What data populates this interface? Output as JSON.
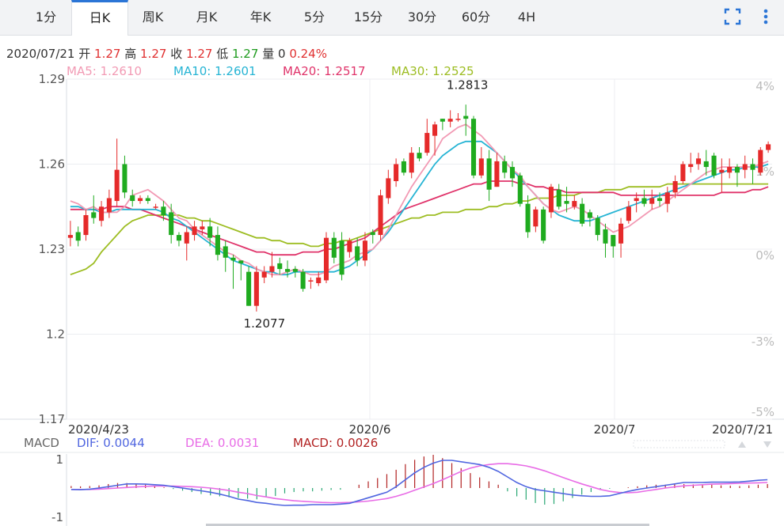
{
  "tabs": [
    {
      "label": "1分",
      "active": false
    },
    {
      "label": "日K",
      "active": true
    },
    {
      "label": "周K",
      "active": false
    },
    {
      "label": "月K",
      "active": false
    },
    {
      "label": "年K",
      "active": false
    },
    {
      "label": "5分",
      "active": false
    },
    {
      "label": "15分",
      "active": false
    },
    {
      "label": "30分",
      "active": false
    },
    {
      "label": "60分",
      "active": false
    },
    {
      "label": "4H",
      "active": false
    }
  ],
  "tools": {
    "fullscreen_icon": "fullscreen-icon",
    "more_icon": "more-vertical-icon"
  },
  "info": {
    "date": "2020/07/21",
    "open_label": "开",
    "open": "1.27",
    "high_label": "高",
    "high": "1.27",
    "close_label": "收",
    "close": "1.27",
    "low_label": "低",
    "low": "1.27",
    "vol_label": "量",
    "vol": "0",
    "change": "0.24%"
  },
  "ma": {
    "ma5": "MA5: 1.2610",
    "ma10": "MA10: 1.2601",
    "ma20": "MA20: 1.2517",
    "ma30": "MA30: 1.2525"
  },
  "macd_labels": {
    "title": "MACD",
    "dif": "DIF: 0.0044",
    "dea": "DEA: 0.0031",
    "macd": "MACD: 0.0026"
  },
  "colors": {
    "up": "#e52a2a",
    "down": "#1fab1f",
    "ma5": "#f29ab4",
    "ma10": "#26b4d4",
    "ma20": "#e0336a",
    "ma30": "#9dbd22",
    "dif": "#5066e0",
    "dea": "#e86ce6",
    "hist_pos": "#b22222",
    "hist_neg": "#2aa874"
  },
  "chart_data": {
    "type": "candlestick",
    "price_axis": {
      "ylim": [
        1.17,
        1.29
      ],
      "ticks": [
        "1.29",
        "1.26",
        "1.23",
        "1.2",
        "1.17"
      ]
    },
    "pct_axis": {
      "ticks": [
        "4%",
        "1%",
        "0%",
        "-3%",
        "-5%"
      ]
    },
    "x_labels": [
      "2020/4/23",
      "2020/6",
      "2020/7",
      "2020/7/21"
    ],
    "annotations": {
      "max": "1.2813",
      "min": "1.2077"
    },
    "candles": [
      [
        1.234,
        1.235,
        1.24,
        1.231
      ],
      [
        1.236,
        1.233,
        1.238,
        1.231
      ],
      [
        1.235,
        1.242,
        1.244,
        1.233
      ],
      [
        1.243,
        1.241,
        1.249,
        1.239
      ],
      [
        1.24,
        1.245,
        1.247,
        1.238
      ],
      [
        1.243,
        1.248,
        1.251,
        1.241
      ],
      [
        1.247,
        1.258,
        1.269,
        1.245
      ],
      [
        1.26,
        1.25,
        1.263,
        1.248
      ],
      [
        1.249,
        1.247,
        1.251,
        1.245
      ],
      [
        1.247,
        1.248,
        1.249,
        1.246
      ],
      [
        1.248,
        1.247,
        1.249,
        1.246
      ],
      [
        1.245,
        1.245,
        1.246,
        1.244
      ],
      [
        1.245,
        1.242,
        1.247,
        1.24
      ],
      [
        1.243,
        1.235,
        1.246,
        1.232
      ],
      [
        1.235,
        1.233,
        1.236,
        1.231
      ],
      [
        1.232,
        1.236,
        1.238,
        1.226
      ],
      [
        1.235,
        1.238,
        1.24,
        1.233
      ],
      [
        1.237,
        1.238,
        1.24,
        1.235
      ],
      [
        1.238,
        1.234,
        1.241,
        1.231
      ],
      [
        1.235,
        1.228,
        1.238,
        1.226
      ],
      [
        1.231,
        1.227,
        1.233,
        1.222
      ],
      [
        1.227,
        1.226,
        1.228,
        1.216
      ],
      [
        1.226,
        1.225,
        1.226,
        1.219
      ],
      [
        1.222,
        1.21,
        1.224,
        1.21
      ],
      [
        1.21,
        1.222,
        1.224,
        1.208
      ],
      [
        1.22,
        1.222,
        1.224,
        1.218
      ],
      [
        1.222,
        1.224,
        1.229,
        1.22
      ],
      [
        1.225,
        1.223,
        1.227,
        1.221
      ],
      [
        1.223,
        1.222,
        1.226,
        1.22
      ],
      [
        1.223,
        1.222,
        1.224,
        1.22
      ],
      [
        1.222,
        1.216,
        1.223,
        1.215
      ],
      [
        1.219,
        1.219,
        1.22,
        1.216
      ],
      [
        1.218,
        1.22,
        1.222,
        1.217
      ],
      [
        1.219,
        1.234,
        1.236,
        1.218
      ],
      [
        1.234,
        1.227,
        1.236,
        1.225
      ],
      [
        1.233,
        1.221,
        1.236,
        1.219
      ],
      [
        1.229,
        1.233,
        1.234,
        1.227
      ],
      [
        1.231,
        1.226,
        1.234,
        1.224
      ],
      [
        1.226,
        1.233,
        1.236,
        1.224
      ],
      [
        1.236,
        1.235,
        1.237,
        1.232
      ],
      [
        1.235,
        1.249,
        1.251,
        1.233
      ],
      [
        1.248,
        1.255,
        1.258,
        1.246
      ],
      [
        1.254,
        1.26,
        1.262,
        1.252
      ],
      [
        1.261,
        1.257,
        1.262,
        1.256
      ],
      [
        1.257,
        1.264,
        1.266,
        1.255
      ],
      [
        1.264,
        1.262,
        1.266,
        1.261
      ],
      [
        1.264,
        1.271,
        1.276,
        1.263
      ],
      [
        1.27,
        1.274,
        1.275,
        1.263
      ],
      [
        1.276,
        1.275,
        1.276,
        1.272
      ],
      [
        1.275,
        1.276,
        1.279,
        1.273
      ],
      [
        1.276,
        1.276,
        1.278,
        1.275
      ],
      [
        1.277,
        1.276,
        1.281,
        1.27
      ],
      [
        1.276,
        1.256,
        1.277,
        1.255
      ],
      [
        1.256,
        1.262,
        1.266,
        1.255
      ],
      [
        1.262,
        1.251,
        1.265,
        1.247
      ],
      [
        1.252,
        1.261,
        1.264,
        1.252
      ],
      [
        1.261,
        1.257,
        1.263,
        1.255
      ],
      [
        1.259,
        1.255,
        1.261,
        1.252
      ],
      [
        1.256,
        1.246,
        1.257,
        1.245
      ],
      [
        1.246,
        1.236,
        1.249,
        1.234
      ],
      [
        1.238,
        1.244,
        1.245,
        1.236
      ],
      [
        1.244,
        1.233,
        1.245,
        1.232
      ],
      [
        1.243,
        1.252,
        1.253,
        1.241
      ],
      [
        1.251,
        1.245,
        1.253,
        1.244
      ],
      [
        1.247,
        1.246,
        1.252,
        1.243
      ],
      [
        1.245,
        1.247,
        1.249,
        1.244
      ],
      [
        1.246,
        1.239,
        1.248,
        1.238
      ],
      [
        1.243,
        1.241,
        1.244,
        1.238
      ],
      [
        1.241,
        1.235,
        1.242,
        1.233
      ],
      [
        1.237,
        1.232,
        1.239,
        1.227
      ],
      [
        1.235,
        1.231,
        1.235,
        1.227
      ],
      [
        1.232,
        1.239,
        1.241,
        1.227
      ],
      [
        1.24,
        1.245,
        1.247,
        1.239
      ],
      [
        1.247,
        1.248,
        1.25,
        1.243
      ],
      [
        1.248,
        1.246,
        1.251,
        1.245
      ],
      [
        1.246,
        1.248,
        1.251,
        1.244
      ],
      [
        1.248,
        1.247,
        1.25,
        1.245
      ],
      [
        1.246,
        1.25,
        1.252,
        1.243
      ],
      [
        1.25,
        1.254,
        1.256,
        1.248
      ],
      [
        1.254,
        1.26,
        1.261,
        1.253
      ],
      [
        1.259,
        1.26,
        1.264,
        1.257
      ],
      [
        1.26,
        1.262,
        1.264,
        1.258
      ],
      [
        1.261,
        1.259,
        1.265,
        1.256
      ],
      [
        1.263,
        1.256,
        1.264,
        1.255
      ],
      [
        1.257,
        1.258,
        1.262,
        1.25
      ],
      [
        1.257,
        1.259,
        1.262,
        1.255
      ],
      [
        1.259,
        1.257,
        1.26,
        1.252
      ],
      [
        1.258,
        1.26,
        1.263,
        1.255
      ],
      [
        1.26,
        1.258,
        1.262,
        1.253
      ],
      [
        1.257,
        1.265,
        1.266,
        1.256
      ],
      [
        1.265,
        1.267,
        1.268,
        1.264
      ]
    ],
    "ma5": [
      1.247,
      1.246,
      1.244,
      1.245,
      1.243,
      1.243,
      1.243,
      1.245,
      1.249,
      1.25,
      1.251,
      1.249,
      1.247,
      1.244,
      1.241,
      1.24,
      1.237,
      1.235,
      1.233,
      1.231,
      1.229,
      1.228,
      1.226,
      1.225,
      1.223,
      1.222,
      1.221,
      1.221,
      1.222,
      1.223,
      1.222,
      1.221,
      1.221,
      1.222,
      1.224,
      1.225,
      1.226,
      1.228,
      1.229,
      1.23,
      1.233,
      1.237,
      1.242,
      1.247,
      1.252,
      1.256,
      1.26,
      1.264,
      1.269,
      1.271,
      1.273,
      1.274,
      1.272,
      1.27,
      1.267,
      1.264,
      1.261,
      1.258,
      1.256,
      1.252,
      1.249,
      1.246,
      1.244,
      1.243,
      1.244,
      1.245,
      1.244,
      1.242,
      1.24,
      1.238,
      1.236,
      1.237,
      1.238,
      1.24,
      1.242,
      1.244,
      1.245,
      1.247,
      1.249,
      1.251,
      1.253,
      1.255,
      1.257,
      1.258,
      1.259,
      1.259,
      1.259,
      1.259,
      1.259,
      1.26,
      1.261
    ],
    "ma10": [
      1.245,
      1.245,
      1.244,
      1.244,
      1.243,
      1.243,
      1.244,
      1.244,
      1.244,
      1.244,
      1.244,
      1.244,
      1.243,
      1.241,
      1.24,
      1.238,
      1.236,
      1.234,
      1.232,
      1.23,
      1.228,
      1.226,
      1.225,
      1.224,
      1.223,
      1.222,
      1.222,
      1.221,
      1.221,
      1.222,
      1.222,
      1.222,
      1.222,
      1.222,
      1.222,
      1.223,
      1.224,
      1.226,
      1.228,
      1.23,
      1.233,
      1.236,
      1.24,
      1.244,
      1.248,
      1.252,
      1.256,
      1.26,
      1.263,
      1.265,
      1.267,
      1.268,
      1.268,
      1.268,
      1.266,
      1.264,
      1.261,
      1.258,
      1.255,
      1.252,
      1.249,
      1.246,
      1.244,
      1.242,
      1.241,
      1.24,
      1.24,
      1.24,
      1.241,
      1.242,
      1.243,
      1.244,
      1.245,
      1.246,
      1.247,
      1.248,
      1.249,
      1.25,
      1.251,
      1.252,
      1.253,
      1.254,
      1.255,
      1.256,
      1.257,
      1.258,
      1.258,
      1.259,
      1.259,
      1.259,
      1.26
    ],
    "ma20": [
      1.244,
      1.244,
      1.244,
      1.244,
      1.244,
      1.245,
      1.245,
      1.245,
      1.244,
      1.244,
      1.243,
      1.242,
      1.241,
      1.24,
      1.239,
      1.238,
      1.237,
      1.236,
      1.235,
      1.234,
      1.233,
      1.232,
      1.231,
      1.23,
      1.229,
      1.229,
      1.228,
      1.228,
      1.228,
      1.228,
      1.229,
      1.229,
      1.229,
      1.23,
      1.23,
      1.231,
      1.232,
      1.233,
      1.234,
      1.236,
      1.238,
      1.24,
      1.242,
      1.244,
      1.245,
      1.246,
      1.247,
      1.248,
      1.249,
      1.25,
      1.251,
      1.252,
      1.253,
      1.253,
      1.254,
      1.254,
      1.254,
      1.254,
      1.253,
      1.253,
      1.252,
      1.252,
      1.251,
      1.251,
      1.25,
      1.25,
      1.25,
      1.25,
      1.25,
      1.25,
      1.25,
      1.249,
      1.249,
      1.249,
      1.249,
      1.249,
      1.249,
      1.249,
      1.249,
      1.249,
      1.249,
      1.249,
      1.249,
      1.249,
      1.25,
      1.25,
      1.25,
      1.25,
      1.251,
      1.251,
      1.252
    ],
    "ma30": [
      1.221,
      1.222,
      1.223,
      1.225,
      1.229,
      1.232,
      1.235,
      1.238,
      1.24,
      1.241,
      1.242,
      1.242,
      1.242,
      1.242,
      1.242,
      1.241,
      1.241,
      1.24,
      1.24,
      1.239,
      1.238,
      1.237,
      1.236,
      1.235,
      1.234,
      1.234,
      1.233,
      1.233,
      1.232,
      1.232,
      1.232,
      1.231,
      1.231,
      1.232,
      1.232,
      1.233,
      1.233,
      1.234,
      1.235,
      1.236,
      1.237,
      1.238,
      1.239,
      1.24,
      1.241,
      1.241,
      1.242,
      1.242,
      1.243,
      1.243,
      1.243,
      1.244,
      1.244,
      1.244,
      1.245,
      1.245,
      1.246,
      1.246,
      1.247,
      1.247,
      1.248,
      1.248,
      1.248,
      1.249,
      1.249,
      1.249,
      1.25,
      1.25,
      1.25,
      1.251,
      1.251,
      1.251,
      1.252,
      1.252,
      1.252,
      1.252,
      1.252,
      1.253,
      1.253,
      1.253,
      1.253,
      1.253,
      1.253,
      1.253,
      1.253,
      1.253,
      1.253,
      1.253,
      1.253,
      1.253,
      1.253
    ],
    "macd": {
      "ylim": [
        -1,
        1
      ],
      "ticks": [
        "1",
        "-1"
      ],
      "dif": [
        -0.05,
        -0.06,
        -0.04,
        0.0,
        0.05,
        0.1,
        0.15,
        0.15,
        0.14,
        0.12,
        0.1,
        0.05,
        0.0,
        -0.05,
        -0.1,
        -0.15,
        -0.22,
        -0.3,
        -0.4,
        -0.45,
        -0.52,
        -0.55,
        -0.6,
        -0.63,
        -0.62,
        -0.62,
        -0.6,
        -0.6,
        -0.6,
        -0.58,
        -0.55,
        -0.45,
        -0.35,
        -0.25,
        -0.15,
        0.05,
        0.3,
        0.55,
        0.75,
        0.9,
        1.0,
        1.0,
        0.95,
        0.9,
        0.85,
        0.75,
        0.6,
        0.4,
        0.2,
        0.05,
        -0.05,
        -0.1,
        -0.15,
        -0.2,
        -0.25,
        -0.28,
        -0.3,
        -0.3,
        -0.28,
        -0.2,
        -0.12,
        -0.05,
        0.0,
        0.05,
        0.1,
        0.15,
        0.2,
        0.2,
        0.2,
        0.21,
        0.21,
        0.21,
        0.22,
        0.25,
        0.28,
        0.3
      ],
      "dea": [
        -0.05,
        -0.05,
        -0.05,
        -0.04,
        -0.02,
        0.0,
        0.02,
        0.04,
        0.06,
        0.07,
        0.07,
        0.07,
        0.06,
        0.05,
        0.03,
        0.0,
        -0.04,
        -0.09,
        -0.15,
        -0.2,
        -0.27,
        -0.32,
        -0.38,
        -0.42,
        -0.46,
        -0.48,
        -0.5,
        -0.52,
        -0.53,
        -0.53,
        -0.52,
        -0.5,
        -0.47,
        -0.43,
        -0.38,
        -0.3,
        -0.2,
        -0.08,
        0.04,
        0.16,
        0.3,
        0.45,
        0.6,
        0.72,
        0.8,
        0.85,
        0.88,
        0.88,
        0.85,
        0.8,
        0.72,
        0.62,
        0.5,
        0.38,
        0.26,
        0.15,
        0.05,
        -0.05,
        -0.12,
        -0.16,
        -0.17,
        -0.15,
        -0.1,
        -0.05,
        0.0,
        0.04,
        0.08,
        0.1,
        0.12,
        0.14,
        0.15,
        0.16,
        0.17,
        0.18,
        0.19,
        0.2
      ],
      "hist": [
        0.06,
        0.05,
        0.06,
        0.08,
        0.12,
        0.15,
        0.15,
        0.14,
        0.1,
        0.07,
        0.02,
        -0.03,
        -0.08,
        -0.12,
        -0.18,
        -0.22,
        -0.25,
        -0.28,
        -0.3,
        -0.32,
        -0.34,
        -0.28,
        -0.24,
        -0.16,
        -0.12,
        -0.1,
        -0.1,
        -0.08,
        -0.06,
        -0.05,
        0.0,
        0.1,
        0.2,
        0.3,
        0.42,
        0.55,
        0.72,
        0.85,
        0.95,
        1.0,
        0.9,
        0.75,
        0.6,
        0.45,
        0.32,
        0.2,
        0.1,
        -0.1,
        -0.25,
        -0.35,
        -0.45,
        -0.5,
        -0.48,
        -0.4,
        -0.3,
        -0.2,
        -0.12,
        -0.06,
        -0.02,
        0.0,
        0.02,
        0.05,
        0.08,
        0.1,
        0.1,
        0.12,
        0.12,
        0.11,
        0.1,
        0.1,
        0.08,
        0.07,
        0.06,
        0.08,
        0.1,
        0.12
      ]
    }
  }
}
